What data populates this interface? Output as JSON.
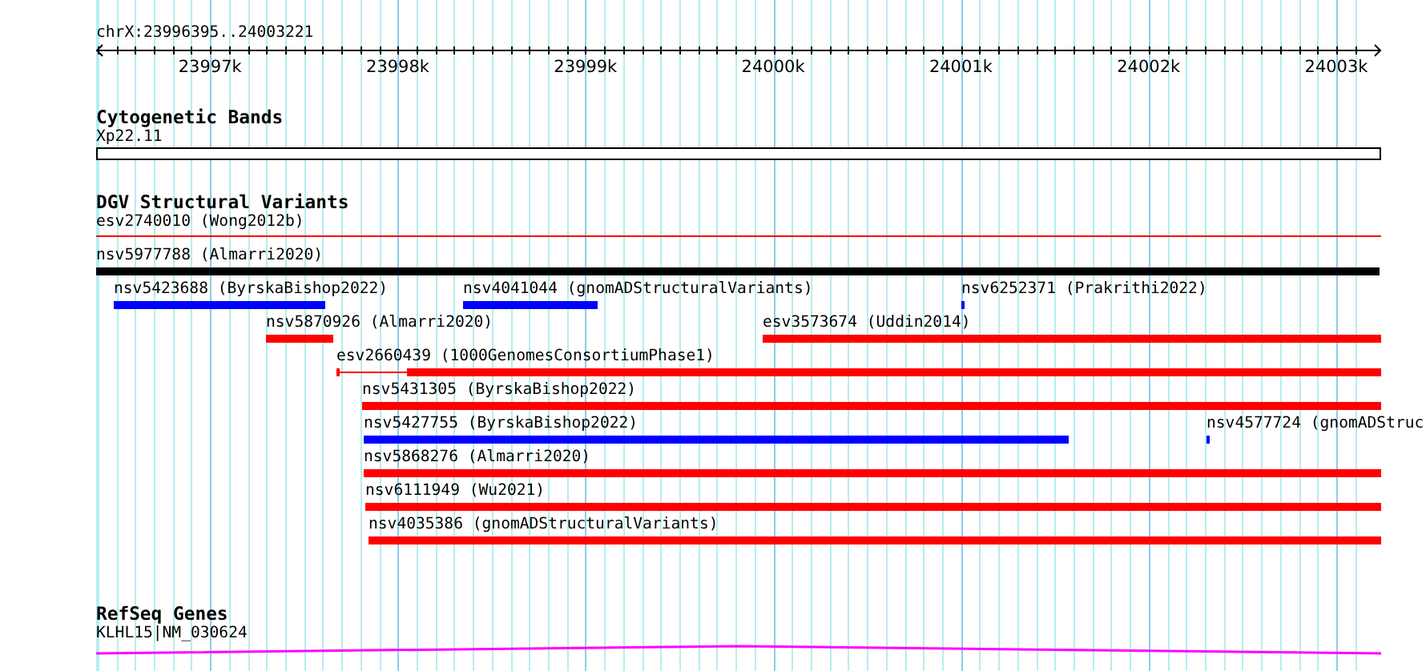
{
  "locus": "chrX:23996395..24003221",
  "ruler": {
    "ticks": [
      "23997k",
      "23998k",
      "23999k",
      "24000k",
      "24001k",
      "24002k",
      "24003k"
    ]
  },
  "tracks": [
    {
      "kind": "cytoband",
      "title": "Cytogenetic Bands",
      "features": [
        {
          "label": "Xp22.11"
        }
      ]
    },
    {
      "kind": "variants",
      "title": "DGV Structural Variants",
      "rows": [
        [
          {
            "kind": "line",
            "label": "esv2740010 (Wong2012b)",
            "color": "#ff0000"
          }
        ],
        [
          {
            "kind": "bar",
            "label": "nsv5977788 (Almarri2020)",
            "color": "#000000"
          }
        ],
        [
          {
            "kind": "bar",
            "label": "nsv5423688 (ByrskaBishop2022)",
            "color": "#0000ff"
          },
          {
            "kind": "bar",
            "label": "nsv4041044 (gnomADStructuralVariants)",
            "color": "#0000ff"
          },
          {
            "kind": "bar",
            "label": "nsv6252371 (Prakrithi2022)",
            "color": "#0000ff"
          }
        ],
        [
          {
            "kind": "bar",
            "label": "nsv5870926 (Almarri2020)",
            "color": "#ff0000"
          },
          {
            "kind": "bar",
            "label": "esv3573674 (Uddin2014)",
            "color": "#ff0000"
          }
        ],
        [
          {
            "kind": "gapped",
            "label": "esv2660439 (1000GenomesConsortiumPhase1)",
            "color": "#ff0000"
          }
        ],
        [
          {
            "kind": "bar",
            "label": "nsv5431305 (ByrskaBishop2022)",
            "color": "#ff0000"
          }
        ],
        [
          {
            "kind": "bar",
            "label": "nsv5427755 (ByrskaBishop2022)",
            "color": "#0000ff"
          },
          {
            "kind": "bar",
            "label": "nsv4577724 (gnomADStruc",
            "color": "#0000ff"
          }
        ],
        [
          {
            "kind": "bar",
            "label": "nsv5868276 (Almarri2020)",
            "color": "#ff0000"
          }
        ],
        [
          {
            "kind": "bar",
            "label": "nsv6111949 (Wu2021)",
            "color": "#ff0000"
          }
        ],
        [
          {
            "kind": "bar",
            "label": "nsv4035386 (gnomADStructuralVariants)",
            "color": "#ff0000"
          }
        ]
      ]
    },
    {
      "kind": "genes",
      "title": "RefSeq Genes",
      "features": [
        {
          "label": "KLHL15|NM_030624"
        }
      ]
    }
  ]
}
